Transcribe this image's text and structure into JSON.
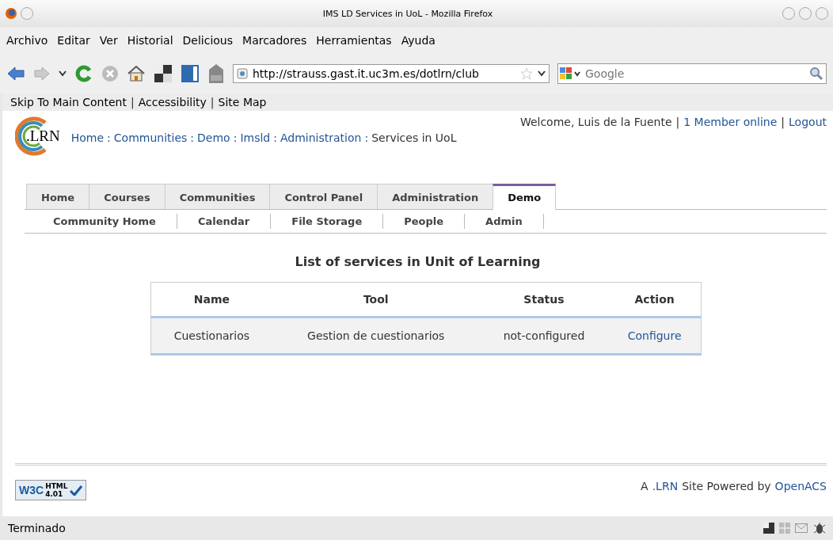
{
  "window": {
    "title": "IMS LD Services in UoL - Mozilla Firefox"
  },
  "menu": [
    "Archivo",
    "Editar",
    "Ver",
    "Historial",
    "Delicious",
    "Marcadores",
    "Herramientas",
    "Ayuda"
  ],
  "toolbar": {
    "url": "http://strauss.gast.it.uc3m.es/dotlrn/club",
    "search_placeholder": "Google"
  },
  "skip_bar": {
    "links": [
      "Skip To Main Content",
      "Accessibility",
      "Site Map"
    ],
    "separator": "|"
  },
  "header": {
    "logo_text": ".LRN",
    "welcome": "Welcome, Luis de la Fuente",
    "separator": "|",
    "links": [
      "1 Member online",
      "Logout"
    ],
    "breadcrumb_separator": ":",
    "breadcrumb": [
      {
        "label": "Home",
        "kind": "link"
      },
      {
        "label": "Communities",
        "kind": "link"
      },
      {
        "label": "Demo",
        "kind": "link"
      },
      {
        "label": "Imsld",
        "kind": "link"
      },
      {
        "label": "Administration",
        "kind": "link"
      },
      {
        "label": "Services in UoL",
        "kind": "text"
      }
    ]
  },
  "tabs": [
    {
      "label": "Home",
      "selected": false
    },
    {
      "label": "Courses",
      "selected": false
    },
    {
      "label": "Communities",
      "selected": false
    },
    {
      "label": "Control Panel",
      "selected": false
    },
    {
      "label": "Administration",
      "selected": false
    },
    {
      "label": "Demo",
      "selected": true
    }
  ],
  "subnav": [
    "Community Home",
    "Calendar",
    "File Storage",
    "People",
    "Admin"
  ],
  "heading": "List of services in Unit of Learning",
  "table": {
    "columns": [
      "Name",
      "Tool",
      "Status",
      "Action"
    ],
    "rows": [
      {
        "name": "Cuestionarios",
        "tool": "Gestion de cuestionarios",
        "status": "not-configured",
        "action": "Configure"
      }
    ]
  },
  "footer": {
    "badge": {
      "logo": "W3C",
      "line_1": "HTML",
      "line_2": "4.01"
    },
    "prefix": "A",
    "lrn_link": ".LRN",
    "middle": "Site Powered by",
    "openacs_link": "OpenACS"
  },
  "status_bar": {
    "text": "Terminado"
  }
}
